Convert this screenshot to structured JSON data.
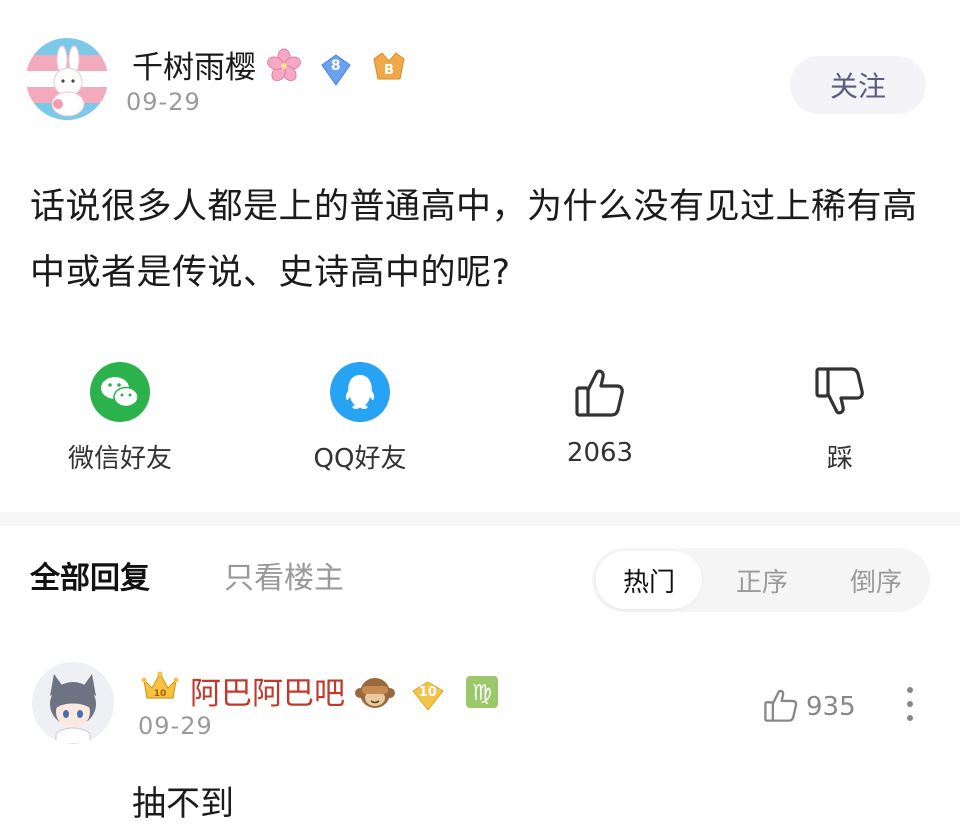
{
  "post": {
    "author": {
      "name": "千树雨樱",
      "date": "09-29",
      "level_badge": "8",
      "icons": [
        "cherry-blossom-emoji",
        "level-diamond-icon",
        "member-badge-icon"
      ]
    },
    "follow_label": "关注",
    "body": "话说很多人都是上的普通高中，为什么没有见过上稀有高中或者是传说、史诗高中的呢?"
  },
  "actions": {
    "wechat_label": "微信好友",
    "qq_label": "QQ好友",
    "like_count": "2063",
    "dislike_label": "踩"
  },
  "reply_tabs": {
    "all_label": "全部回复",
    "op_only_label": "只看楼主",
    "sort": [
      "热门",
      "正序",
      "倒序"
    ],
    "sort_selected": "热门"
  },
  "reply": {
    "author": {
      "name": "阿巴阿巴吧",
      "date": "09-29",
      "level_badge": "10",
      "icons": [
        "crown-icon",
        "see-no-evil-monkey-emoji",
        "level-diamond-icon",
        "virgo-icon"
      ]
    },
    "like_count": "935",
    "text": "抽不到"
  },
  "colors": {
    "wechat_green": "#2bb24c",
    "qq_blue": "#27a3f3",
    "vip_name_red": "#c0392b",
    "muted_gray": "#9a9a9a",
    "follow_bg": "#f3f3f8"
  }
}
